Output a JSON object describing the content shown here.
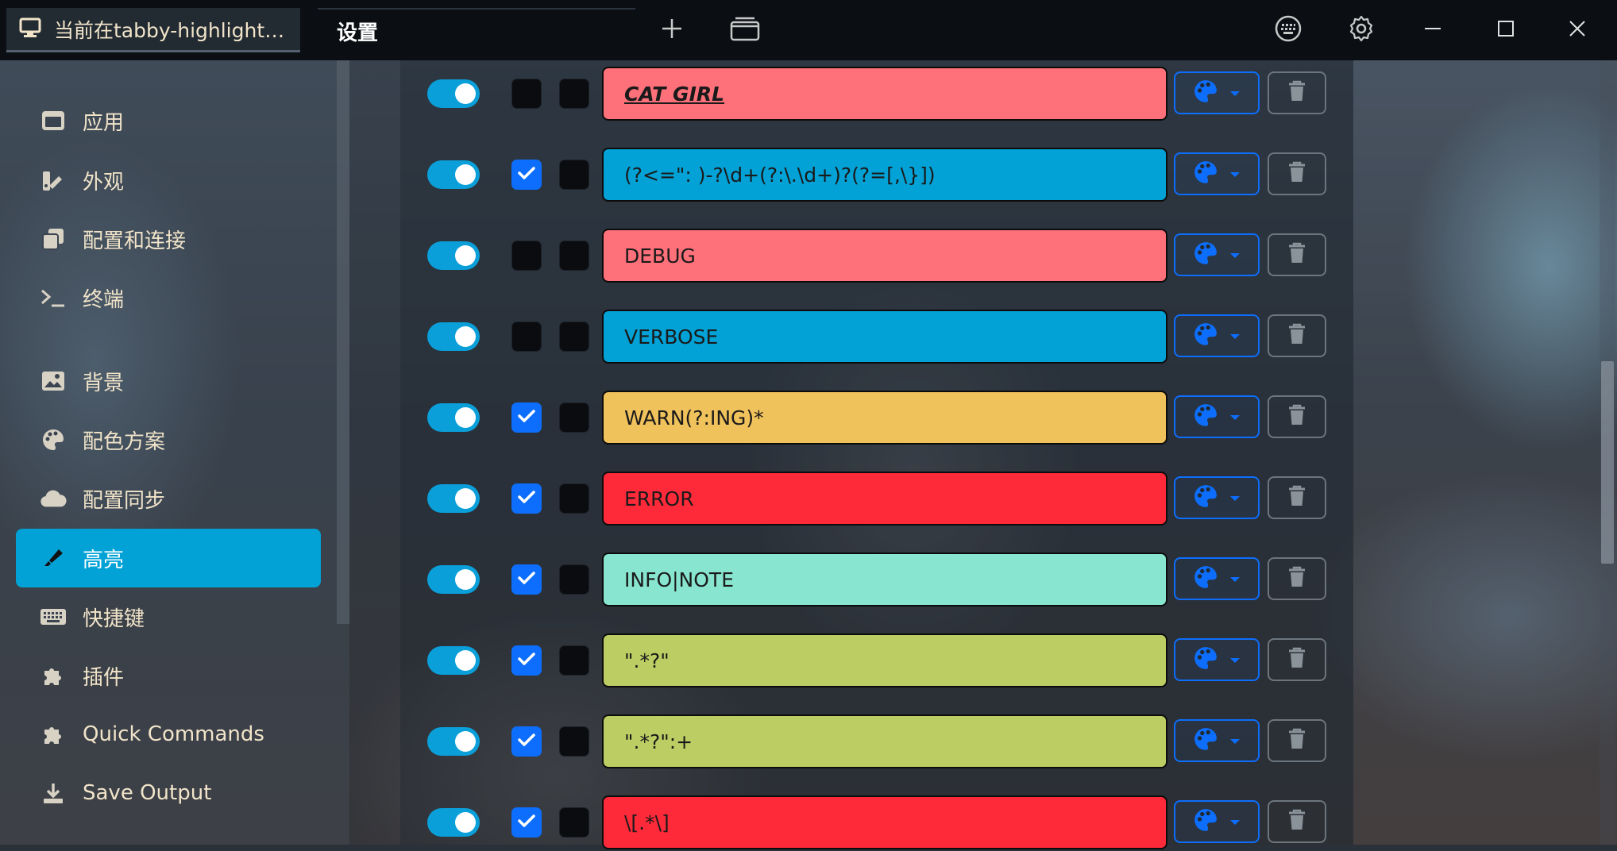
{
  "titlebar": {
    "tab_title": "当前在tabby-highlight…",
    "settings_tab": "设置"
  },
  "sidebar": {
    "items": [
      {
        "label": "应用",
        "icon": "window-icon",
        "active": false
      },
      {
        "label": "外观",
        "icon": "paint-brush-ruler-icon",
        "active": false
      },
      {
        "label": "配置和连接",
        "icon": "copy-icon",
        "active": false
      },
      {
        "label": "终端",
        "icon": "terminal-prompt-icon",
        "active": false
      },
      {
        "label": "背景",
        "icon": "image-icon",
        "active": false
      },
      {
        "label": "配色方案",
        "icon": "palette-icon",
        "active": false
      },
      {
        "label": "配置同步",
        "icon": "cloud-icon",
        "active": false
      },
      {
        "label": "高亮",
        "icon": "highlighter-icon",
        "active": true
      },
      {
        "label": "快捷键",
        "icon": "keyboard-icon",
        "active": false
      },
      {
        "label": "插件",
        "icon": "puzzle-icon",
        "active": false
      },
      {
        "label": "Quick Commands",
        "icon": "puzzle-icon",
        "active": false
      },
      {
        "label": "Save Output",
        "icon": "download-icon",
        "active": false
      }
    ]
  },
  "rules": [
    {
      "pattern": "CAT GIRL",
      "enabled": true,
      "checked": false,
      "color": "#fe707a",
      "styled": true
    },
    {
      "pattern": "(?<=\": )-?\\d+(?:\\.\\d+)?(?=[,\\}])",
      "enabled": true,
      "checked": true,
      "color": "#02a2d6",
      "styled": false
    },
    {
      "pattern": "DEBUG",
      "enabled": true,
      "checked": false,
      "color": "#fe707a",
      "styled": false
    },
    {
      "pattern": "VERBOSE",
      "enabled": true,
      "checked": false,
      "color": "#02a2d6",
      "styled": false
    },
    {
      "pattern": "WARN(?:ING)*",
      "enabled": true,
      "checked": true,
      "color": "#f0c25c",
      "styled": false
    },
    {
      "pattern": "ERROR",
      "enabled": true,
      "checked": true,
      "color": "#fe2a3a",
      "styled": false
    },
    {
      "pattern": "INFO|NOTE",
      "enabled": true,
      "checked": true,
      "color": "#88e6d0",
      "styled": false
    },
    {
      "pattern": "\".*?\"",
      "enabled": true,
      "checked": true,
      "color": "#bccd63",
      "styled": false
    },
    {
      "pattern": "\".*?\":+",
      "enabled": true,
      "checked": true,
      "color": "#bccd63",
      "styled": false
    },
    {
      "pattern": "\\[.*\\]",
      "enabled": true,
      "checked": true,
      "color": "#fe2a3a",
      "styled": false
    }
  ],
  "colors": {
    "accent": "#0d6efd",
    "active_nav": "#02a2d6",
    "toggle_on": "#0a9fd9"
  }
}
